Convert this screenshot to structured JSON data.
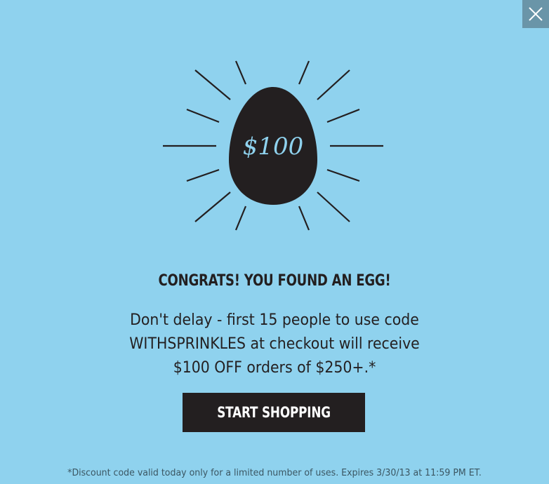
{
  "popup": {
    "close_icon": "close-icon",
    "egg_label": "$100",
    "headline": "CONGRATS! YOU FOUND AN EGG!",
    "body_lines": [
      "Don't delay - first 15 people to use code",
      "WITHSPRINKLES at checkout will receive",
      "$100 OFF orders of $250+.*"
    ],
    "cta_label": "START SHOPPING",
    "disclaimer": "*Discount code valid today only for a limited number of uses. Expires 3/30/13 at 11:59 PM ET."
  },
  "colors": {
    "background": "#8fd2ee",
    "egg": "#231f20",
    "button": "#231f20",
    "close_button": "#6a95a8"
  }
}
